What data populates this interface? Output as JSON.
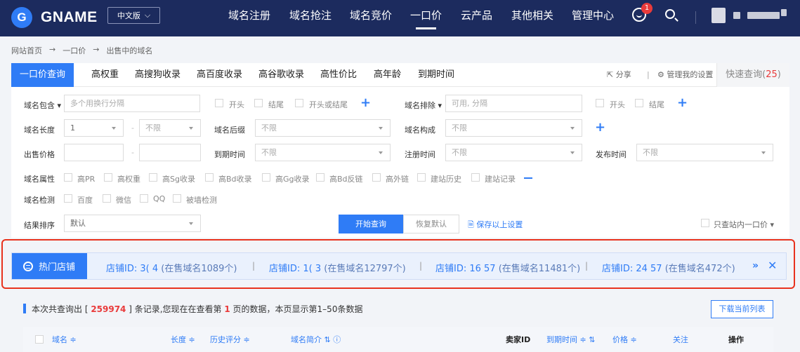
{
  "header": {
    "brand": "GNAME",
    "brand_mark": "G",
    "lang": "中文版",
    "nav": [
      "域名注册",
      "域名抢注",
      "域名竞价",
      "一口价",
      "云产品",
      "其他相关",
      "管理中心"
    ],
    "cart_badge": "1"
  },
  "breadcrumb": [
    "网站首页",
    "→",
    "一口价",
    "→",
    "出售中的域名"
  ],
  "tabs": [
    "一口价查询",
    "高权重",
    "高搜狗收录",
    "高百度收录",
    "高谷歌收录",
    "高性价比",
    "高年龄",
    "到期时间"
  ],
  "tabs_right": {
    "share": "分享",
    "manage": "管理我的设置",
    "quick_label": "快速查询(",
    "quick_count": "25",
    "quick_end": ")"
  },
  "filters": {
    "contains_label": "域名包含",
    "contains_placeholder": "多个用换行分隔",
    "contains_opts": [
      "开头",
      "结尾",
      "开头或结尾"
    ],
    "exclude_label": "域名排除",
    "exclude_placeholder": "可用, 分隔",
    "exclude_opts": [
      "开头",
      "结尾"
    ],
    "length_label": "域名长度",
    "length_min": "1",
    "length_max": "不限",
    "suffix_label": "域名后缀",
    "suffix_value": "不限",
    "composition_label": "域名构成",
    "composition_value": "不限",
    "price_label": "出售价格",
    "expire_label": "到期时间",
    "expire_value": "不限",
    "register_label": "注册时间",
    "register_value": "不限",
    "publish_label": "发布时间",
    "publish_value": "不限",
    "attr_label": "域名属性",
    "attr_opts": [
      "高PR",
      "高权重",
      "高Sg收录",
      "高Bd收录",
      "高Gg收录",
      "高Bd反链",
      "高外链",
      "建站历史",
      "建站记录"
    ],
    "check_label": "域名检测",
    "check_opts": [
      "百度",
      "微信",
      "QQ",
      "被墙检测"
    ],
    "sort_label": "结果排序",
    "sort_value": "默认",
    "search_btn": "开始查询",
    "reset_btn": "恢复默认",
    "save_link": "保存以上设置",
    "only_site": "只查站内一口价"
  },
  "hot_shops": {
    "label": "热门店铺",
    "shops": [
      {
        "id": "店铺ID: 3( ‌4",
        "count": "(在售域名1089个)"
      },
      {
        "id": "店铺ID: 1(  ‌3",
        "count": "(在售域名12797个)"
      },
      {
        "id": "店铺ID: 16  ‌57",
        "count": "(在售域名11481个)"
      },
      {
        "id": "店铺ID: 24  ‌57",
        "count": "(在售域名472个)"
      }
    ],
    "separator": "|",
    "more": "»",
    "close": "✕"
  },
  "summary": {
    "pre": "本次共查询出 [ ",
    "total": "259974",
    "mid1": " ] 条记录,您现在在查看第 ",
    "page": "1",
    "mid2": " 页的数据，本页显示第1–50条数据"
  },
  "download_btn": "下载当前列表",
  "table_headers": [
    "域名 ≑",
    "长度 ≑",
    "历史评分 ≑",
    "域名简介 ⇅ ⓘ",
    "卖家ID",
    "到期时间 ≑ ⇅",
    "价格 ≑",
    "关注",
    "操作"
  ]
}
